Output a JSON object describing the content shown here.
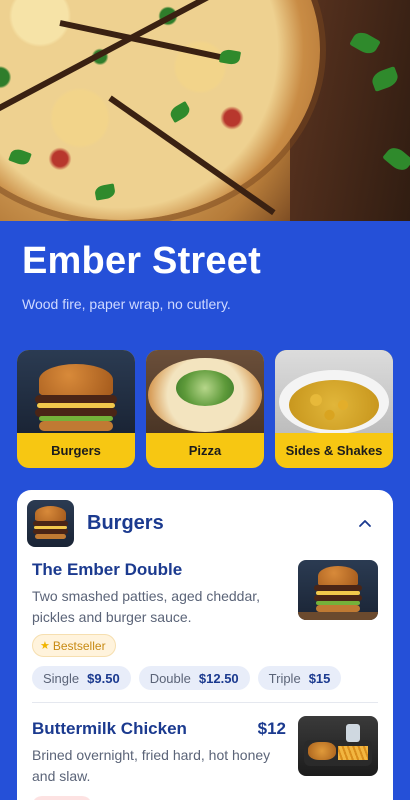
{
  "restaurant": {
    "name": "Ember Street",
    "tagline": "Wood fire, paper wrap, no cutlery."
  },
  "categories": [
    {
      "label": "Burgers",
      "icon": "burger-photo"
    },
    {
      "label": "Pizza",
      "icon": "pizza-photo"
    },
    {
      "label": "Sides & Shakes",
      "icon": "sides-photo"
    }
  ],
  "section": {
    "title": "Burgers",
    "collapse_icon": "chevron-up-icon",
    "items": [
      {
        "name": "The Ember Double",
        "description": "Two smashed patties, aged cheddar, pickles and burger sauce.",
        "badge": "Bestseller",
        "badge_icon": "star-icon",
        "sizes": [
          {
            "label": "Single",
            "price": "$9.50"
          },
          {
            "label": "Double",
            "price": "$12.50"
          },
          {
            "label": "Triple",
            "price": "$15"
          }
        ]
      },
      {
        "name": "Buttermilk Chicken",
        "price": "$12",
        "description": "Brined overnight, fried hard, hot honey and slaw."
      }
    ]
  },
  "colors": {
    "background": "#2550d8",
    "accent_yellow": "#f7c712",
    "heading_blue": "#1b3a8f"
  }
}
